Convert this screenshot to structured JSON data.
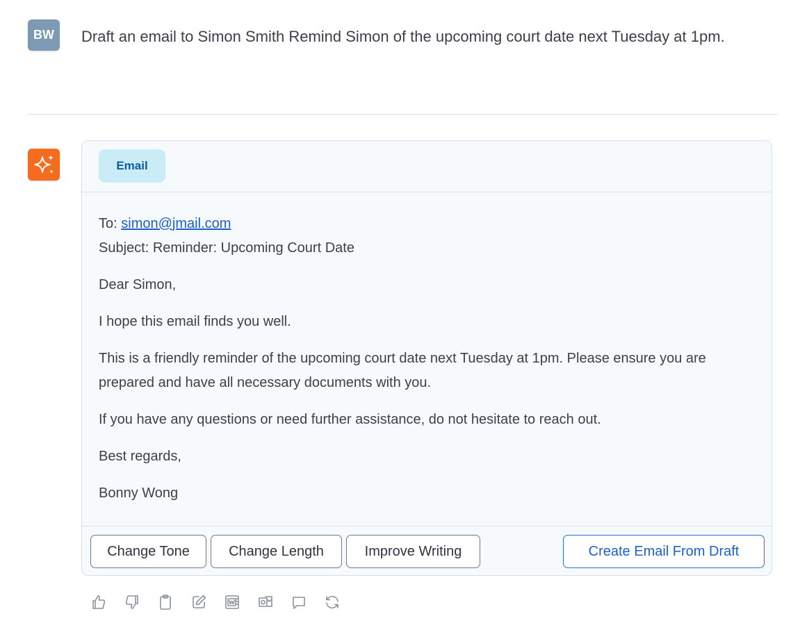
{
  "user": {
    "initials": "BW",
    "message": "Draft an email to Simon Smith Remind Simon of the upcoming court date next Tuesday at 1pm."
  },
  "assistant": {
    "tag_label": "Email",
    "email": {
      "to_label": "To: ",
      "to_address": "simon@jmail.com",
      "subject": "Subject: Reminder: Upcoming Court Date",
      "greeting": "Dear Simon,",
      "paragraph_1": "I hope this email finds you well.",
      "paragraph_2": "This is a friendly reminder of the upcoming court date next Tuesday at 1pm. Please ensure you are prepared and have all necessary documents with you.",
      "paragraph_3": "If you have any questions or need further assistance, do not hesitate to reach out.",
      "closing": "Best regards,",
      "signature": "Bonny Wong"
    },
    "buttons": {
      "change_tone": "Change Tone",
      "change_length": "Change Length",
      "improve_writing": "Improve Writing",
      "create_email": "Create Email From Draft"
    }
  },
  "actions": [
    "thumbs-up-icon",
    "thumbs-down-icon",
    "clipboard-icon",
    "edit-icon",
    "word-icon",
    "outlook-icon",
    "comment-icon",
    "refresh-icon"
  ],
  "colors": {
    "accent": "#1b62c7",
    "ai_avatar": "#f56c1f",
    "user_avatar": "#7d99b3",
    "tag_bg": "#c9ecf6"
  }
}
